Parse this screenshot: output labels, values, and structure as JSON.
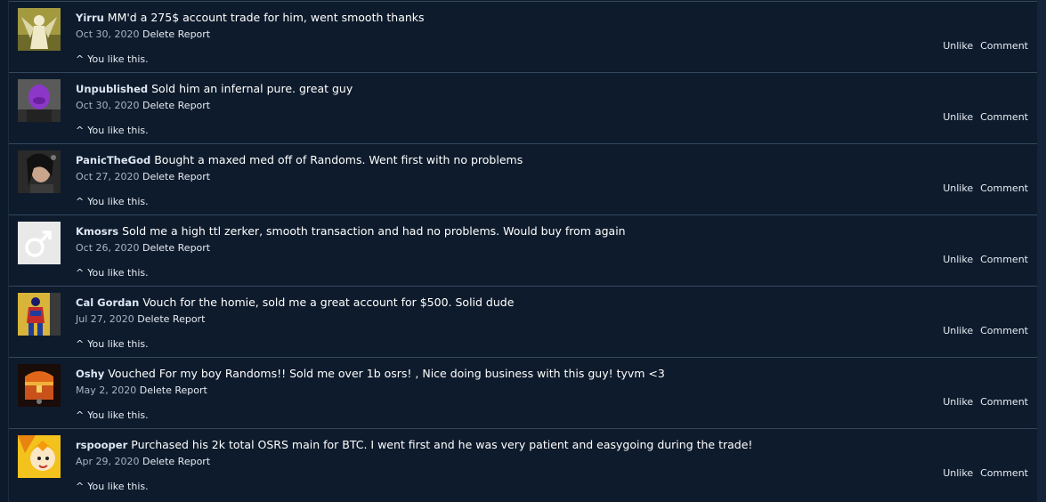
{
  "comments": [
    {
      "user": "Yirru",
      "text": "MM'd a 275$ account trade for him, went smooth thanks",
      "date": "Oct 30, 2020",
      "delete": "Delete",
      "report": "Report",
      "likes": "You like this.",
      "unlike": "Unlike",
      "comment": "Comment",
      "avatar": "angel-avatar"
    },
    {
      "user": "Unpublished",
      "text": "Sold him an infernal pure. great guy",
      "date": "Oct 30, 2020",
      "delete": "Delete",
      "report": "Report",
      "likes": "You like this.",
      "unlike": "Unlike",
      "comment": "Comment",
      "avatar": "purple-mask-avatar"
    },
    {
      "user": "PanicTheGod",
      "text": "Bought a maxed med off of Randoms. Went first with no problems",
      "date": "Oct 27, 2020",
      "delete": "Delete",
      "report": "Report",
      "likes": "You like this.",
      "unlike": "Unlike",
      "comment": "Comment",
      "avatar": "portrait-avatar"
    },
    {
      "user": "Kmosrs",
      "text": "Sold me a high ttl zerker, smooth transaction and had no problems. Would buy from again",
      "date": "Oct 26, 2020",
      "delete": "Delete",
      "report": "Report",
      "likes": "You like this.",
      "unlike": "Unlike",
      "comment": "Comment",
      "avatar": "male-symbol-avatar"
    },
    {
      "user": "Cal Gordan",
      "text": "Vouch for the homie, sold me a great account for $500. Solid dude",
      "date": "Jul 27, 2020",
      "delete": "Delete",
      "report": "Report",
      "likes": "You like this.",
      "unlike": "Unlike",
      "comment": "Comment",
      "avatar": "hero-avatar"
    },
    {
      "user": "Oshy",
      "text": "Vouched For my boy Randoms!! Sold me over 1b osrs! , Nice doing business with this guy! tyvm <3",
      "date": "May 2, 2020",
      "delete": "Delete",
      "report": "Report",
      "likes": "You like this.",
      "unlike": "Unlike",
      "comment": "Comment",
      "avatar": "treasure-chest-avatar"
    },
    {
      "user": "rspooper",
      "text": "Purchased his 2k total OSRS main for BTC. I went first and he was very patient and easygoing during the trade!",
      "date": "Apr 29, 2020",
      "delete": "Delete",
      "report": "Report",
      "likes": "You like this.",
      "unlike": "Unlike",
      "comment": "Comment",
      "avatar": "anime-avatar"
    }
  ],
  "colors": {
    "background": "#0e1b2c",
    "divider": "#34475f",
    "meta": "#a6b4c6",
    "text": "#ffffff"
  }
}
